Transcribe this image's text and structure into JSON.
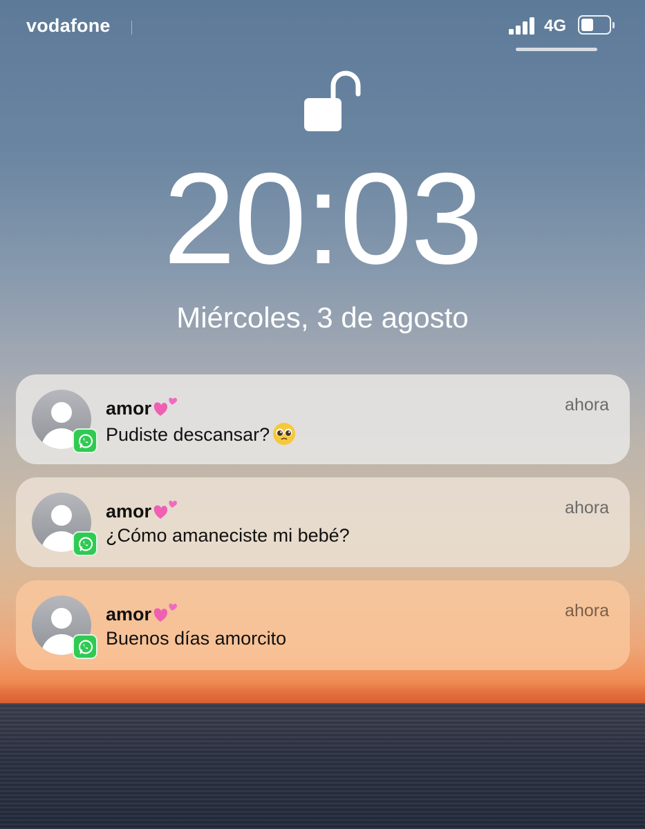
{
  "status_bar": {
    "carrier": "vodafone",
    "network": "4G",
    "signal_bars": 4,
    "battery_level": 0.45
  },
  "lock_screen": {
    "lock_icon": "unlocked-padlock-icon",
    "time": "20:03",
    "date": "Miércoles, 3 de agosto"
  },
  "notifications": [
    {
      "app_icon": "whatsapp-icon",
      "sender": "amor",
      "sender_emoji": "two-hearts-emoji",
      "message": "Pudiste descansar?",
      "message_emoji": "pleading-face-emoji",
      "time": "ahora"
    },
    {
      "app_icon": "whatsapp-icon",
      "sender": "amor",
      "sender_emoji": "two-hearts-emoji",
      "message": "¿Cómo amaneciste mi bebé?",
      "time": "ahora"
    },
    {
      "app_icon": "whatsapp-icon",
      "sender": "amor",
      "sender_emoji": "two-hearts-emoji",
      "message": "Buenos días amorcito",
      "time": "ahora"
    }
  ],
  "colors": {
    "whatsapp_green": "#2fca52",
    "text_primary": "#111111",
    "text_secondary": "#6b6a6a"
  }
}
